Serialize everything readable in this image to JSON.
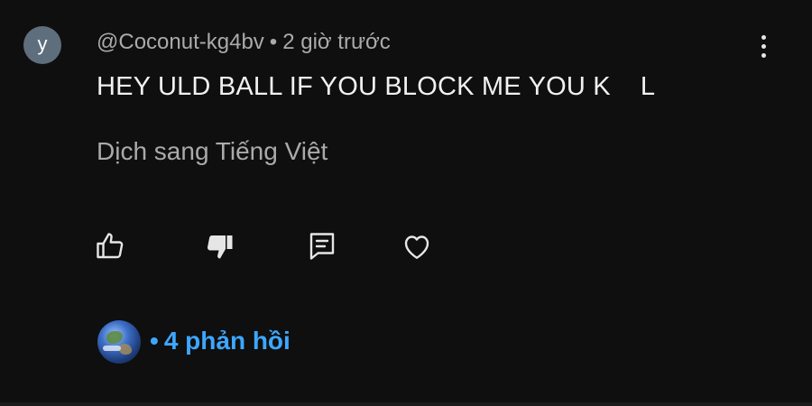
{
  "comment": {
    "avatar_letter": "y",
    "author": "@Coconut-kg4bv",
    "separator": "•",
    "time": "2 giờ trước",
    "text": "HEY ULD BALL IF YOU BLOCK ME YOU K    L",
    "translate_label": "Dịch sang Tiếng Việt"
  },
  "actions": {
    "like_icon": "thumbs-up-icon",
    "dislike_icon": "thumbs-down-icon",
    "reply_icon": "reply-icon",
    "heart_icon": "heart-icon",
    "menu_icon": "more-vert-icon"
  },
  "replies": {
    "separator": "•",
    "label": "4 phản hồi",
    "color": "#3ea6ff"
  },
  "colors": {
    "background": "#0f0f0f",
    "avatar": "#5e6e7c",
    "secondary_text": "#aaaaaa",
    "primary_text": "#f1f1f1"
  }
}
